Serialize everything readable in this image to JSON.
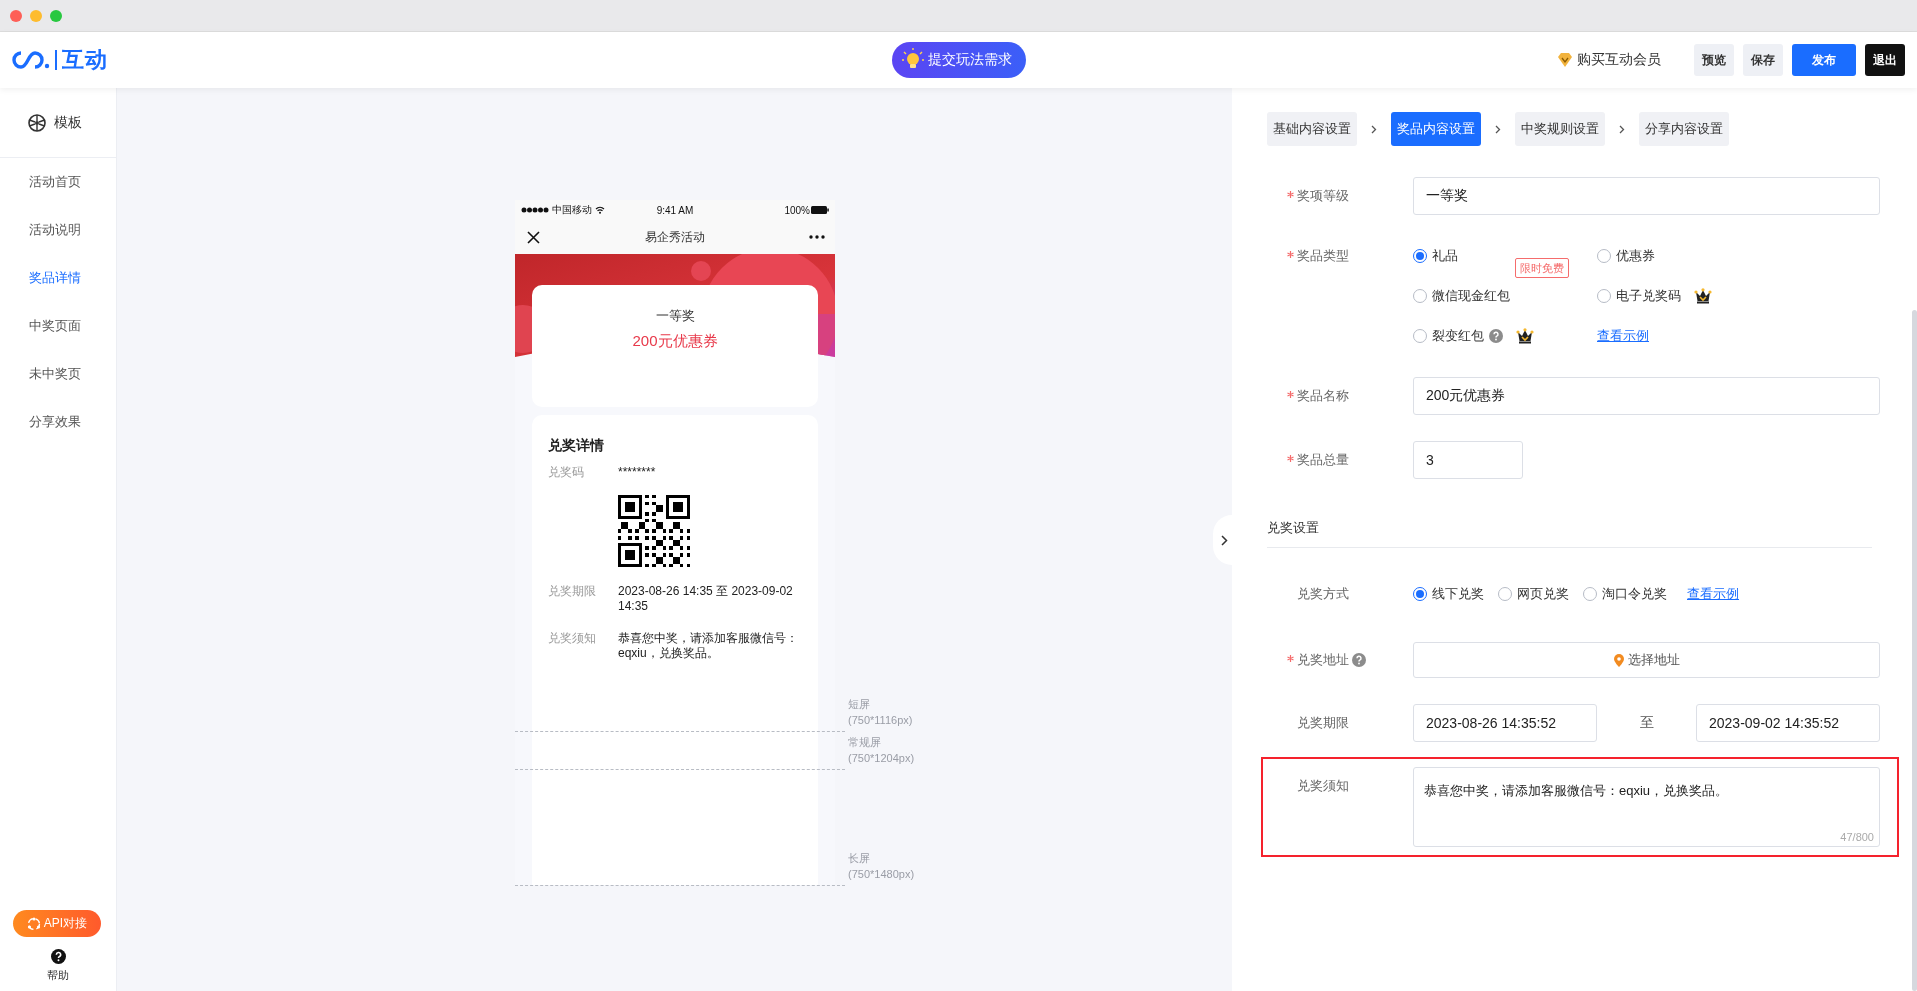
{
  "header": {
    "logo": "互动",
    "center_button": "提交玩法需求",
    "member_link": "购买互动会员",
    "buttons": [
      {
        "label": "预览",
        "kind": "plain"
      },
      {
        "label": "保存",
        "kind": "plain"
      },
      {
        "label": "发布",
        "kind": "primary"
      },
      {
        "label": "退出",
        "kind": "dark"
      }
    ]
  },
  "sidebar": {
    "template": "模板",
    "items": [
      {
        "label": "活动首页",
        "selected": false
      },
      {
        "label": "活动说明",
        "selected": false
      },
      {
        "label": "奖品详情",
        "selected": true
      },
      {
        "label": "中奖页面",
        "selected": false
      },
      {
        "label": "未中奖页",
        "selected": false
      },
      {
        "label": "分享效果",
        "selected": false
      }
    ],
    "api_button": "API对接",
    "help": "帮助"
  },
  "preview": {
    "status_bar": {
      "carrier": "中国移动",
      "time": "9:41 AM",
      "battery": "100%"
    },
    "nav_title": "易企秀活动",
    "prize_card": {
      "level": "一等奖",
      "name": "200元优惠券"
    },
    "details": {
      "title": "兑奖详情",
      "rows": [
        {
          "kind": "text",
          "label": "兑奖码",
          "value": "********"
        },
        {
          "kind": "qr"
        },
        {
          "kind": "text",
          "label": "兑奖期限",
          "value": "2023-08-26 14:35 至 2023-09-02 14:35"
        },
        {
          "kind": "text",
          "label": "兑奖须知",
          "value": "恭喜您中奖，请添加客服微信号：eqxiu，兑换奖品。"
        }
      ]
    },
    "screen_guides": [
      {
        "label": "短屏",
        "size": "(750*1116px)"
      },
      {
        "label": "常规屏",
        "size": "(750*1204px)"
      },
      {
        "label": "长屏",
        "size": "(750*1480px)"
      }
    ]
  },
  "panel": {
    "steps": [
      {
        "label": "基础内容设置",
        "selected": false
      },
      {
        "label": "奖品内容设置",
        "selected": true
      },
      {
        "label": "中奖规则设置",
        "selected": false
      },
      {
        "label": "分享内容设置",
        "selected": false
      }
    ],
    "fields": [
      {
        "kind": "input",
        "label": "奖项等级",
        "required": true,
        "value": "一等奖"
      },
      {
        "kind": "radio-grid",
        "label": "奖品类型",
        "required": true,
        "link": "查看示例",
        "options": [
          {
            "label": "礼品",
            "selected": true,
            "premium": false,
            "help": false
          },
          {
            "label": "优惠券",
            "selected": false,
            "premium": false,
            "help": false
          },
          {
            "label": "微信现金红包",
            "selected": false,
            "premium": false,
            "help": false,
            "badge": "限时免费"
          },
          {
            "label": "电子兑奖码",
            "selected": false,
            "premium": true,
            "help": false
          },
          {
            "label": "裂变红包",
            "selected": false,
            "premium": true,
            "help": true
          }
        ]
      },
      {
        "kind": "input",
        "label": "奖品名称",
        "required": true,
        "value": "200元优惠券"
      },
      {
        "kind": "short-input",
        "label": "奖品总量",
        "required": true,
        "value": "3"
      },
      {
        "kind": "section",
        "label": "兑奖设置"
      },
      {
        "kind": "radio-inline",
        "label": "兑奖方式",
        "required": false,
        "link": "查看示例",
        "options": [
          {
            "label": "线下兑奖",
            "selected": true
          },
          {
            "label": "网页兑奖",
            "selected": false
          },
          {
            "label": "淘口令兑奖",
            "selected": false
          }
        ]
      },
      {
        "kind": "address",
        "label": "兑奖地址",
        "required": true,
        "help": true,
        "button": "选择地址"
      },
      {
        "kind": "daterange",
        "label": "兑奖期限",
        "required": false,
        "start": "2023-08-26 14:35:52",
        "separator": "至",
        "end": "2023-09-02 14:35:52"
      },
      {
        "kind": "textarea",
        "label": "兑奖须知",
        "required": false,
        "highlighted": true,
        "value": "恭喜您中奖，请添加客服微信号：eqxiu，兑换奖品。",
        "counter": "47/800"
      }
    ]
  }
}
